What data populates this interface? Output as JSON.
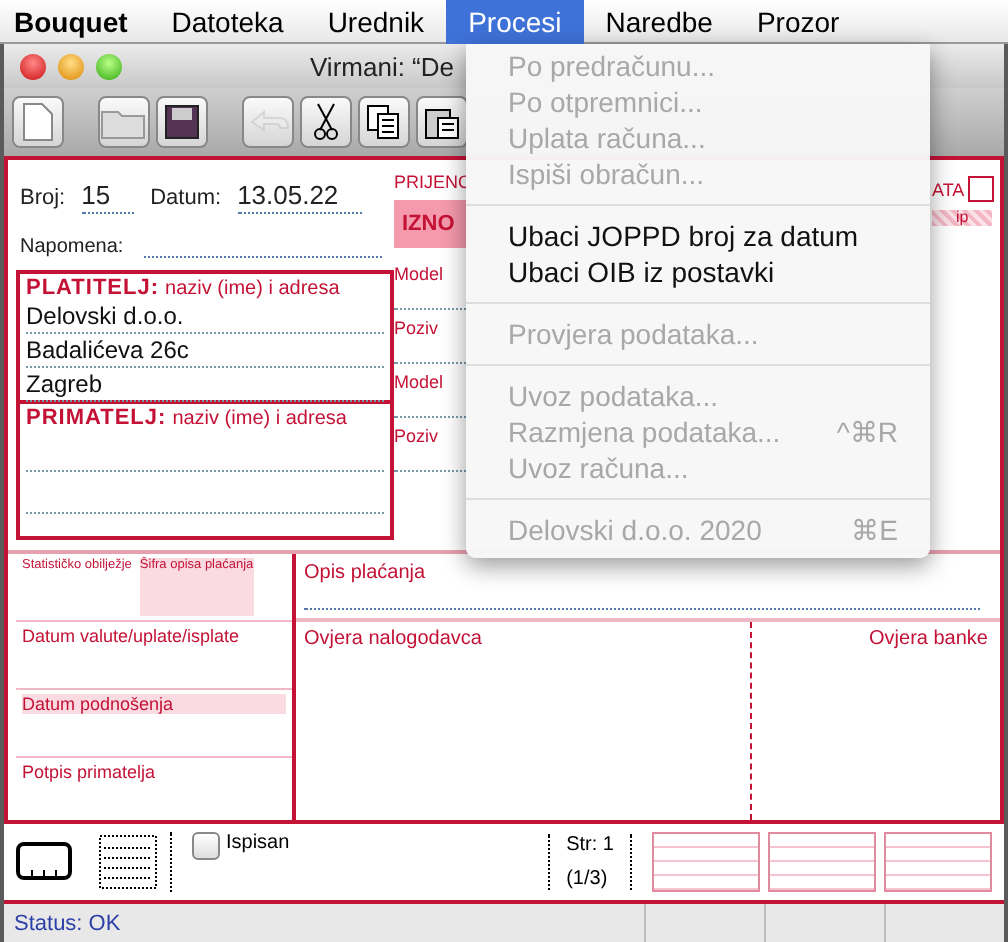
{
  "menubar": [
    {
      "label": "Bouquet",
      "selected": false,
      "kind": "app"
    },
    {
      "label": "Datoteka",
      "selected": false,
      "kind": "menu"
    },
    {
      "label": "Urednik",
      "selected": false,
      "kind": "menu"
    },
    {
      "label": "Procesi",
      "selected": true,
      "kind": "menu"
    },
    {
      "label": "Naredbe",
      "selected": false,
      "kind": "menu"
    },
    {
      "label": "Prozor",
      "selected": false,
      "kind": "menu"
    }
  ],
  "window": {
    "title": "Virmani: “De"
  },
  "toolbar": [
    {
      "kind": "new",
      "disabled": false
    },
    {
      "kind": "open",
      "disabled": false
    },
    {
      "kind": "save",
      "disabled": false
    },
    {
      "kind": "undo",
      "disabled": true
    },
    {
      "kind": "cut",
      "disabled": false
    },
    {
      "kind": "copy",
      "disabled": false
    },
    {
      "kind": "paste",
      "disabled": false
    }
  ],
  "form": {
    "broj_label": "Broj:",
    "broj": "15",
    "datum_label": "Datum:",
    "datum": "13.05.22",
    "napomena_label": "Napomena:",
    "platitelj": {
      "title": "PLATITELJ:",
      "hint": "naziv (ime) i adresa",
      "lines": [
        "Delovski d.o.o.",
        "Badalićeva 26c",
        "Zagreb"
      ]
    },
    "primatelj": {
      "title": "PRIMATELJ:",
      "hint": "naziv (ime) i adresa"
    },
    "middle": [
      "PRIJENO",
      "IZNO",
      "Model",
      "Poziv",
      "Model",
      "Poziv"
    ],
    "right": {
      "label": "ATA",
      "checked": false,
      "strip": "ip"
    },
    "statisticko": "Statističko obilježje",
    "sifra": "Šifra opisa plaćanja",
    "opis": "Opis plaćanja",
    "datum_valute": "Datum valute/uplate/isplate",
    "datum_podnosenja": "Datum podnošenja",
    "potpis": "Potpis primatelja",
    "ovjera_nalogodavca": "Ovjera nalogodavca",
    "ovjera_banke": "Ovjera banke"
  },
  "bottom": {
    "ispisan": {
      "label": "Ispisan",
      "checked": false
    },
    "page": "Str: 1",
    "page_count": "(1/3)"
  },
  "status_bar": "Status: OK",
  "menu": [
    {
      "kind": "item",
      "label": "Po predračunu...",
      "disabled": true
    },
    {
      "kind": "item",
      "label": "Po otpremnici...",
      "disabled": true
    },
    {
      "kind": "item",
      "label": "Uplata računa...",
      "disabled": true
    },
    {
      "kind": "item",
      "label": "Ispiši obračun...",
      "disabled": true
    },
    {
      "kind": "separator"
    },
    {
      "kind": "item",
      "label": "Ubaci JOPPD broj za datum",
      "disabled": false
    },
    {
      "kind": "item",
      "label": "Ubaci OIB iz postavki",
      "disabled": false
    },
    {
      "kind": "separator"
    },
    {
      "kind": "item",
      "label": "Provjera podataka...",
      "disabled": true
    },
    {
      "kind": "separator"
    },
    {
      "kind": "item",
      "label": "Uvoz podataka...",
      "disabled": true
    },
    {
      "kind": "item",
      "label": "Razmjena podataka...",
      "disabled": true,
      "shortcut": "^⌘R"
    },
    {
      "kind": "item",
      "label": "Uvoz računa...",
      "disabled": true
    },
    {
      "kind": "separator"
    },
    {
      "kind": "item",
      "label": "Delovski d.o.o. 2020",
      "disabled": true,
      "shortcut": "⌘E"
    }
  ]
}
